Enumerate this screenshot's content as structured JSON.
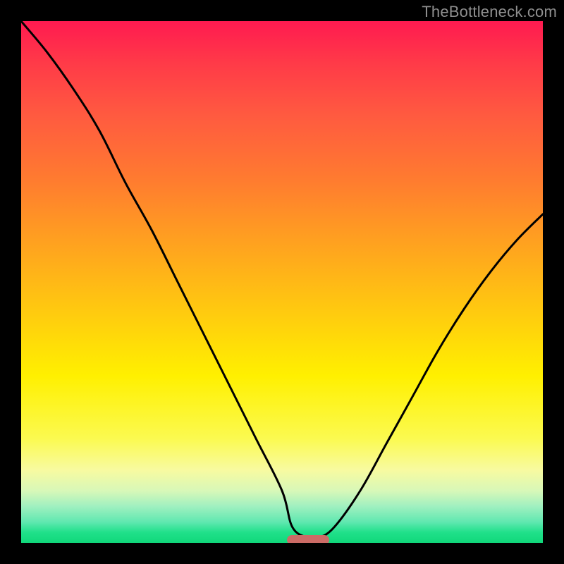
{
  "watermark": "TheBottleneck.com",
  "chart_data": {
    "type": "line",
    "title": "",
    "xlabel": "",
    "ylabel": "",
    "xlim": [
      0,
      100
    ],
    "ylim": [
      0,
      100
    ],
    "grid": false,
    "legend": false,
    "series": [
      {
        "name": "bottleneck-curve",
        "x": [
          0,
          5,
          10,
          15,
          20,
          25,
          30,
          35,
          40,
          45,
          50,
          52,
          55,
          57,
          60,
          65,
          70,
          75,
          80,
          85,
          90,
          95,
          100
        ],
        "values": [
          100,
          94,
          87,
          79,
          69,
          60,
          50,
          40,
          30,
          20,
          10,
          3,
          1,
          1,
          3,
          10,
          19,
          28,
          37,
          45,
          52,
          58,
          63
        ]
      }
    ],
    "optimal_marker": {
      "x_start": 51,
      "x_end": 59,
      "y": 0.5
    }
  },
  "colors": {
    "background": "#000000",
    "curve": "#000000",
    "marker": "#cc6b66",
    "watermark": "#8f8f8f"
  }
}
